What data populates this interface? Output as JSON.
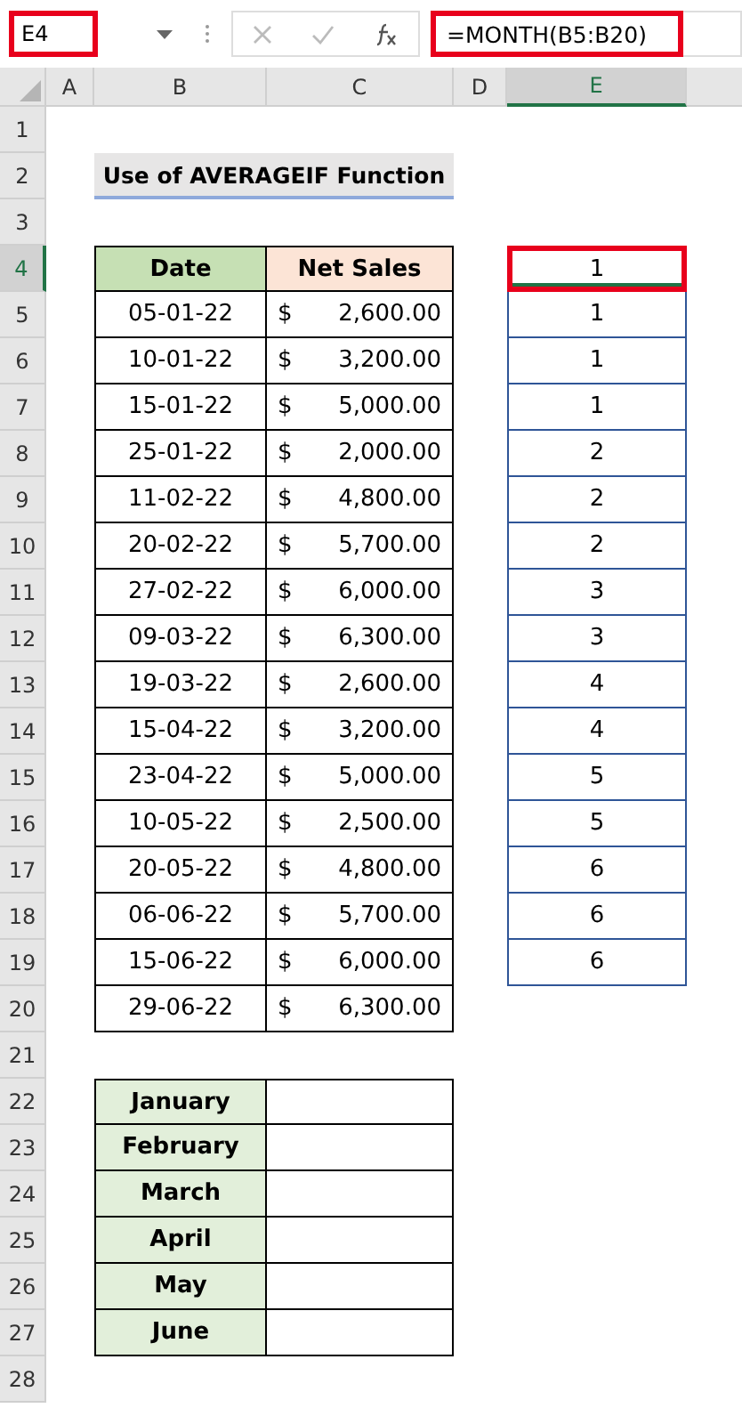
{
  "formula_bar": {
    "name_box": {
      "value": "E4",
      "highlighted": true
    },
    "formula": {
      "value": "=MONTH(B5:B20)",
      "highlighted": true
    }
  },
  "columns": [
    {
      "label": "A",
      "selected": false
    },
    {
      "label": "B",
      "selected": false
    },
    {
      "label": "C",
      "selected": false
    },
    {
      "label": "D",
      "selected": false
    },
    {
      "label": "E",
      "selected": true
    }
  ],
  "rows": [
    {
      "label": "1",
      "selected": false
    },
    {
      "label": "2",
      "selected": false
    },
    {
      "label": "3",
      "selected": false
    },
    {
      "label": "4",
      "selected": true
    },
    {
      "label": "5",
      "selected": false
    },
    {
      "label": "6",
      "selected": false
    },
    {
      "label": "7",
      "selected": false
    },
    {
      "label": "8",
      "selected": false
    },
    {
      "label": "9",
      "selected": false
    },
    {
      "label": "10",
      "selected": false
    },
    {
      "label": "11",
      "selected": false
    },
    {
      "label": "12",
      "selected": false
    },
    {
      "label": "13",
      "selected": false
    },
    {
      "label": "14",
      "selected": false
    },
    {
      "label": "15",
      "selected": false
    },
    {
      "label": "16",
      "selected": false
    },
    {
      "label": "17",
      "selected": false
    },
    {
      "label": "18",
      "selected": false
    },
    {
      "label": "19",
      "selected": false
    },
    {
      "label": "20",
      "selected": false
    },
    {
      "label": "21",
      "selected": false
    },
    {
      "label": "22",
      "selected": false
    },
    {
      "label": "23",
      "selected": false
    },
    {
      "label": "24",
      "selected": false
    },
    {
      "label": "25",
      "selected": false
    },
    {
      "label": "26",
      "selected": false
    },
    {
      "label": "27",
      "selected": false
    },
    {
      "label": "28",
      "selected": false
    }
  ],
  "title": "Use of AVERAGEIF Function",
  "sales_table": {
    "headers": [
      "Date",
      "Net Sales"
    ],
    "rows": [
      {
        "date": "05-01-22",
        "currency": "$",
        "amount": "2,600.00"
      },
      {
        "date": "10-01-22",
        "currency": "$",
        "amount": "3,200.00"
      },
      {
        "date": "15-01-22",
        "currency": "$",
        "amount": "5,000.00"
      },
      {
        "date": "25-01-22",
        "currency": "$",
        "amount": "2,000.00"
      },
      {
        "date": "11-02-22",
        "currency": "$",
        "amount": "4,800.00"
      },
      {
        "date": "20-02-22",
        "currency": "$",
        "amount": "5,700.00"
      },
      {
        "date": "27-02-22",
        "currency": "$",
        "amount": "6,000.00"
      },
      {
        "date": "09-03-22",
        "currency": "$",
        "amount": "6,300.00"
      },
      {
        "date": "19-03-22",
        "currency": "$",
        "amount": "2,600.00"
      },
      {
        "date": "15-04-22",
        "currency": "$",
        "amount": "3,200.00"
      },
      {
        "date": "23-04-22",
        "currency": "$",
        "amount": "5,000.00"
      },
      {
        "date": "10-05-22",
        "currency": "$",
        "amount": "2,500.00"
      },
      {
        "date": "20-05-22",
        "currency": "$",
        "amount": "4,800.00"
      },
      {
        "date": "06-06-22",
        "currency": "$",
        "amount": "5,700.00"
      },
      {
        "date": "15-06-22",
        "currency": "$",
        "amount": "6,000.00"
      },
      {
        "date": "29-06-22",
        "currency": "$",
        "amount": "6,300.00"
      }
    ]
  },
  "month_column": [
    {
      "value": "1",
      "selected": true
    },
    {
      "value": "1",
      "selected": false
    },
    {
      "value": "1",
      "selected": false
    },
    {
      "value": "1",
      "selected": false
    },
    {
      "value": "2",
      "selected": false
    },
    {
      "value": "2",
      "selected": false
    },
    {
      "value": "2",
      "selected": false
    },
    {
      "value": "3",
      "selected": false
    },
    {
      "value": "3",
      "selected": false
    },
    {
      "value": "4",
      "selected": false
    },
    {
      "value": "4",
      "selected": false
    },
    {
      "value": "5",
      "selected": false
    },
    {
      "value": "5",
      "selected": false
    },
    {
      "value": "6",
      "selected": false
    },
    {
      "value": "6",
      "selected": false
    },
    {
      "value": "6",
      "selected": false
    }
  ],
  "months_table": [
    "January",
    "February",
    "March",
    "April",
    "May",
    "June"
  ]
}
